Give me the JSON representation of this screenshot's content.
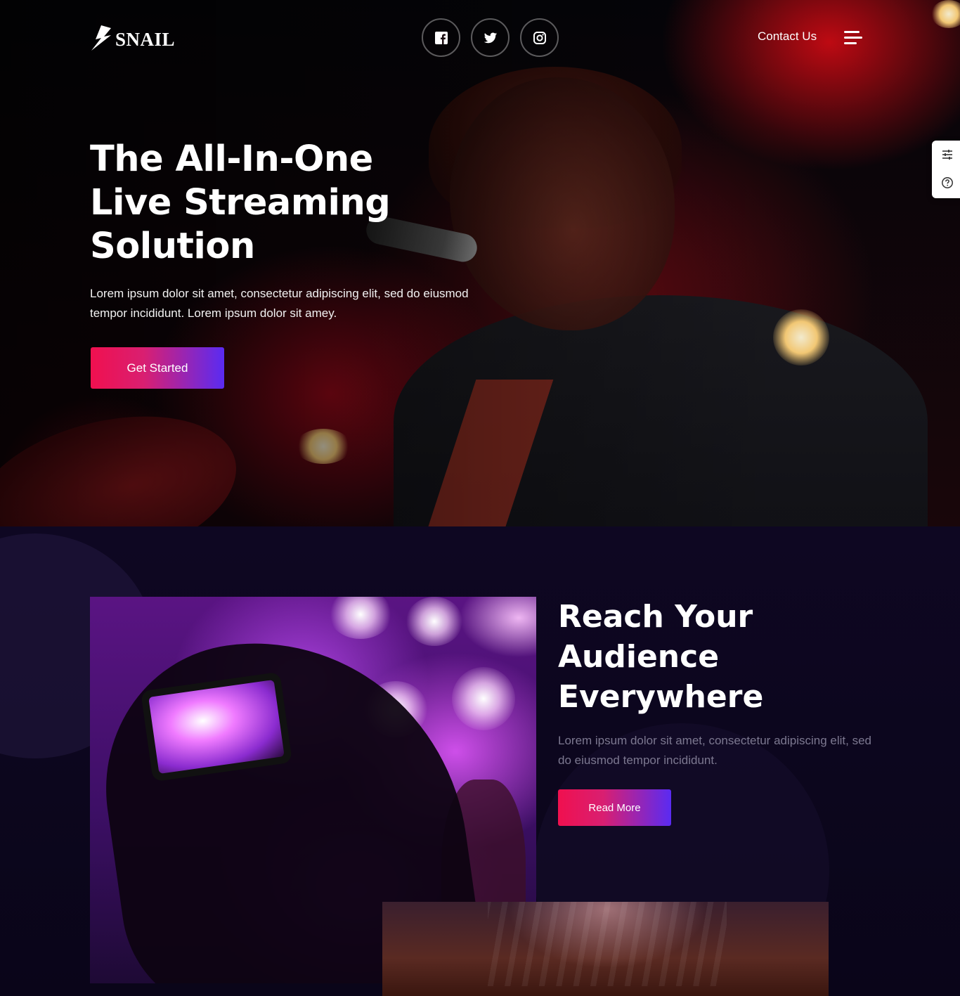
{
  "brand": {
    "name": "SNAIL",
    "logo_icon": "lightning-bolt-icon"
  },
  "header": {
    "socials": [
      {
        "name": "facebook",
        "icon": "facebook-icon"
      },
      {
        "name": "twitter",
        "icon": "twitter-icon"
      },
      {
        "name": "instagram",
        "icon": "instagram-icon"
      }
    ],
    "contact_label": "Contact Us",
    "menu_icon": "hamburger-menu-icon"
  },
  "side_widget": {
    "icons": [
      "sliders-icon",
      "help-circle-icon"
    ]
  },
  "hero": {
    "title_lines": [
      "The All-In-One",
      "Live Streaming",
      "Solution"
    ],
    "subtitle": "Lorem ipsum dolor sit amet, consectetur adipiscing elit, sed do eiusmod tempor incididunt. Lorem ipsum dolor sit amey.",
    "cta_label": "Get Started"
  },
  "feature": {
    "title_lines": [
      "Reach Your",
      "Audience",
      "Everywhere"
    ],
    "subtitle": "Lorem ipsum dolor sit amet, consectetur adipiscing elit, sed do eiusmod tempor incididunt.",
    "cta_label": "Read More"
  },
  "colors": {
    "accent_start": "#f0104f",
    "accent_end": "#5a2bf2",
    "section_bg": "#0a0519",
    "muted_text": "#7c7890"
  }
}
